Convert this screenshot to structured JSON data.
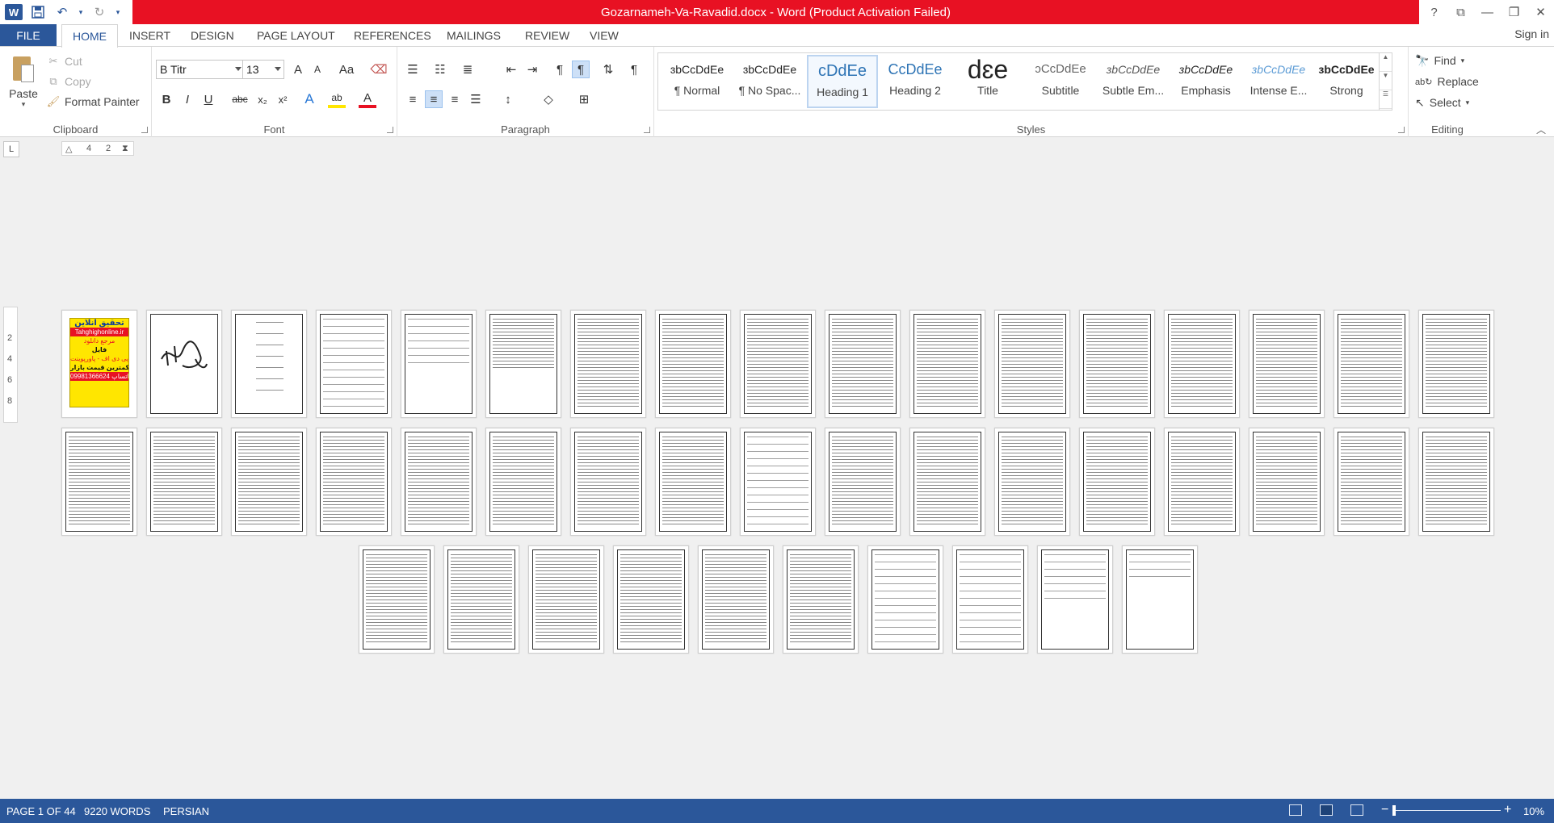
{
  "window": {
    "title": "Gozarnameh-Va-Ravadid.docx -  Word (Product Activation Failed)",
    "help": "?",
    "controls": [
      "⧉",
      "—",
      "❐",
      "✕"
    ]
  },
  "qat": {
    "undo": "↶",
    "redo": "↻"
  },
  "tabs": {
    "file": "FILE",
    "items": [
      "HOME",
      "INSERT",
      "DESIGN",
      "PAGE LAYOUT",
      "REFERENCES",
      "MAILINGS",
      "REVIEW",
      "VIEW"
    ],
    "signin": "Sign in"
  },
  "clipboard": {
    "paste": "Paste",
    "cut": "Cut",
    "copy": "Copy",
    "format_painter": "Format Painter",
    "label": "Clipboard"
  },
  "font": {
    "family": "B Titr",
    "size": "13",
    "grow": "A",
    "shrink": "A",
    "change_case": "Aa",
    "bold": "B",
    "italic": "I",
    "underline": "U",
    "strike": "abc",
    "subscript": "x₂",
    "superscript": "x²",
    "text_effects": "A",
    "highlight": "ab",
    "font_color": "A",
    "label": "Font"
  },
  "paragraph": {
    "label": "Paragraph",
    "pilcrow": "¶"
  },
  "styles": {
    "label": "Styles",
    "items": [
      {
        "sample": "ɜbCcDdEe",
        "name": "¶ Normal"
      },
      {
        "sample": "ɜbCcDdEe",
        "name": "¶ No Spac..."
      },
      {
        "sample": "cDdEe",
        "name": "Heading 1"
      },
      {
        "sample": "CcDdEe",
        "name": "Heading 2"
      },
      {
        "sample": "dɛe",
        "name": "Title"
      },
      {
        "sample": "ↄCcDdEe",
        "name": "Subtitle"
      },
      {
        "sample": "ɜbCcDdEe",
        "name": "Subtle Em..."
      },
      {
        "sample": "ɜbCcDdEe",
        "name": "Emphasis"
      },
      {
        "sample": "ɜbCcDdEe",
        "name": "Intense E..."
      },
      {
        "sample": "ɜbCcDdEe",
        "name": "Strong"
      }
    ]
  },
  "editing": {
    "find": "Find",
    "replace": "Replace",
    "select": "Select",
    "label": "Editing"
  },
  "ruler": {
    "tab_selector": "L",
    "marks": [
      "4",
      "2"
    ],
    "vmarks": [
      "2",
      "4",
      "6",
      "8"
    ]
  },
  "cover_page": {
    "line1": "تحقیق آنلاین",
    "line2": "Tahghighonline.ir",
    "line3": "مرجع دانلود",
    "line4": "فایل",
    "line5": "ورد-پی دی اف - پاورپوینت",
    "line6": "با کمترین قیمت بازار",
    "line7": "09981366624 واتساپ"
  },
  "status": {
    "page": "PAGE 1 OF 44",
    "words": "9220 WORDS",
    "language": "PERSIAN",
    "zoom_minus": "−",
    "zoom_plus": "+",
    "zoom": "10%"
  },
  "colors": {
    "accent": "#2b579a",
    "activation_bar": "#e81123",
    "cover": "#ffe600"
  }
}
